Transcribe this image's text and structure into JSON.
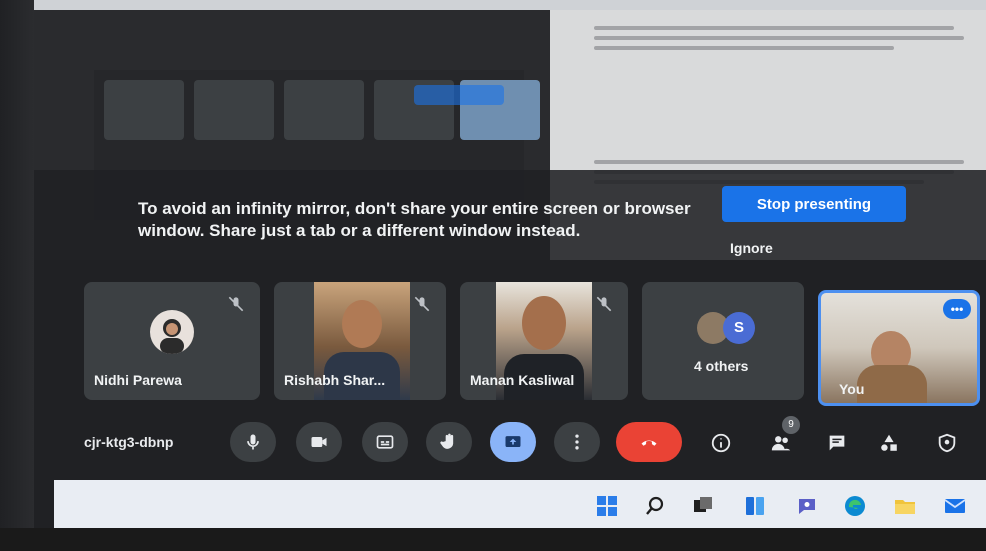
{
  "banner": {
    "message": "To avoid an infinity mirror, don't share your entire screen or browser window. Share just a tab or a different window instead.",
    "stop_label": "Stop presenting",
    "ignore_label": "Ignore"
  },
  "participants": [
    {
      "name": "Nidhi Parewa",
      "muted": true
    },
    {
      "name": "Rishabh Shar...",
      "muted": true
    },
    {
      "name": "Manan Kasliwal",
      "muted": true
    },
    {
      "name": "4 others",
      "avatar_letter": "S"
    },
    {
      "name": "You"
    }
  ],
  "meeting": {
    "code": "cjr-ktg3-dbnp",
    "participants_badge": "9"
  },
  "controls": [
    {
      "name": "microphone",
      "icon": "mic-icon"
    },
    {
      "name": "camera",
      "icon": "camera-icon"
    },
    {
      "name": "captions",
      "icon": "captions-icon"
    },
    {
      "name": "raise-hand",
      "icon": "hand-icon"
    },
    {
      "name": "present",
      "icon": "present-icon",
      "active": true
    },
    {
      "name": "more-options",
      "icon": "more-vert-icon"
    },
    {
      "name": "leave-call",
      "icon": "call-end-icon"
    }
  ],
  "colors": {
    "primary": "#1a73e8",
    "end_call": "#ea4335",
    "active_control": "#8ab4f8",
    "tile": "#3c4043",
    "background": "#202124"
  }
}
